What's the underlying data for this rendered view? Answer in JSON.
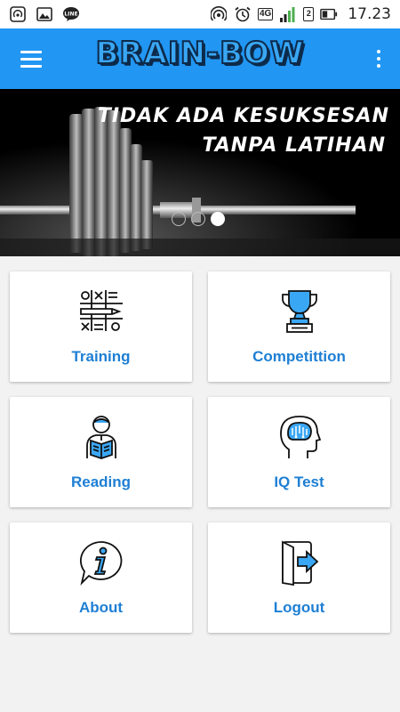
{
  "status_bar": {
    "time": "17.23",
    "network": "4G",
    "sim": "2",
    "icons": [
      "hotspot-icon",
      "gallery-icon",
      "line-app-icon",
      "wifi-tethering-icon",
      "alarm-icon",
      "signal-icon",
      "battery-icon"
    ]
  },
  "app_bar": {
    "title": "BRAIN-BOW",
    "color": "#2196f3"
  },
  "banner": {
    "line1": "TIDAK ADA KESUKSESAN",
    "line2": "TANPA LATIHAN",
    "slide_count": 3,
    "active_slide": 3
  },
  "menu": [
    {
      "label": "Training",
      "icon": "tic-tac-toe-pencil-icon"
    },
    {
      "label": "Competittion",
      "icon": "trophy-icon"
    },
    {
      "label": "Reading",
      "icon": "person-reading-icon"
    },
    {
      "label": "IQ Test",
      "icon": "brain-head-icon"
    },
    {
      "label": "About",
      "icon": "info-bubble-icon"
    },
    {
      "label": "Logout",
      "icon": "logout-door-icon"
    }
  ],
  "accent_color": "#1e7fd4"
}
